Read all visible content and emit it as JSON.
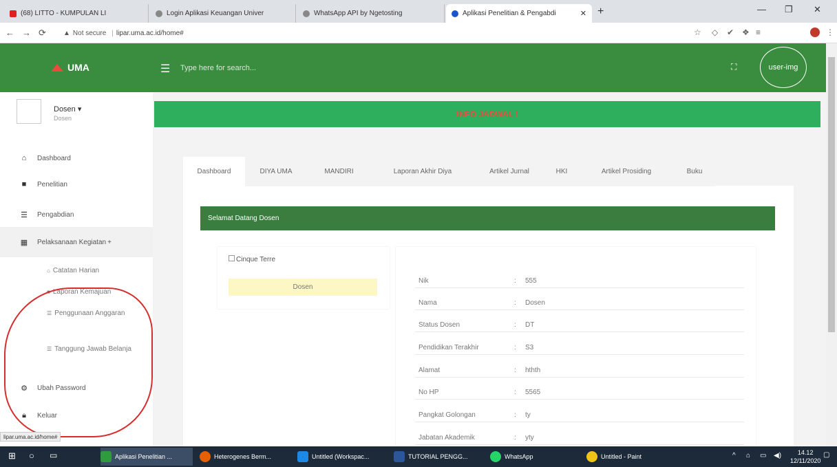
{
  "browser": {
    "tabs": [
      {
        "title": "(68) LITTO - KUMPULAN LI"
      },
      {
        "title": "Login Aplikasi Keuangan Univer"
      },
      {
        "title": "WhatsApp API by Ngetosting"
      },
      {
        "title": "Aplikasi Penelitian & Pengabdi"
      }
    ],
    "url_security": "Not secure",
    "url": "lipar.uma.ac.id/home#",
    "status_url": "lipar.uma.ac.id/home#"
  },
  "header": {
    "brand": "UMA",
    "search_placeholder": "Type here for search...",
    "user_img_alt": "user-img"
  },
  "sidebar": {
    "user_name": "Dosen",
    "user_role": "Dosen",
    "items": [
      {
        "label": "Dashboard"
      },
      {
        "label": "Penelitian"
      },
      {
        "label": "Pengabdian"
      },
      {
        "label": "Pelaksanaan Kegiatan"
      }
    ],
    "subitems": [
      {
        "label": "Catatan Harian"
      },
      {
        "label": "Laporan Kemajuan"
      },
      {
        "label": "Penggunaan Anggaran"
      },
      {
        "label": "Tanggung Jawab Belanja"
      }
    ],
    "bottom_items": [
      {
        "label": "Ubah Password"
      },
      {
        "label": "Keluar"
      }
    ]
  },
  "main": {
    "info_banner": "INFO JADWAL !",
    "tabs": [
      {
        "label": "Dashboard"
      },
      {
        "label": "DIYA UMA"
      },
      {
        "label": "MANDIRI"
      },
      {
        "label": "Laporan Akhir Diya"
      },
      {
        "label": "Artikel Jurnal"
      },
      {
        "label": "HKI"
      },
      {
        "label": "Artikel Prosiding"
      },
      {
        "label": "Buku"
      }
    ],
    "welcome": "Selamat Datang Dosen",
    "profile_img_alt": "Cinque Terre",
    "profile_role": "Dosen",
    "details": [
      {
        "key": "Nik",
        "value": "555"
      },
      {
        "key": "Nama",
        "value": "Dosen"
      },
      {
        "key": "Status Dosen",
        "value": "DT"
      },
      {
        "key": "Pendidikan Terakhir",
        "value": "S3"
      },
      {
        "key": "Alamat",
        "value": "hthth"
      },
      {
        "key": "No HP",
        "value": "5565"
      },
      {
        "key": "Pangkat Golongan",
        "value": "ty"
      },
      {
        "key": "Jabatan Akademik",
        "value": "yty"
      }
    ]
  },
  "taskbar": {
    "items": [
      {
        "label": "Aplikasi Penelitian ..."
      },
      {
        "label": "Heterogenes Berm..."
      },
      {
        "label": "Untitled (Workspac..."
      },
      {
        "label": "TUTORIAL PENGG..."
      },
      {
        "label": "WhatsApp"
      },
      {
        "label": "Untitled - Paint"
      }
    ],
    "time": "14.12",
    "date": "12/11/2020"
  }
}
